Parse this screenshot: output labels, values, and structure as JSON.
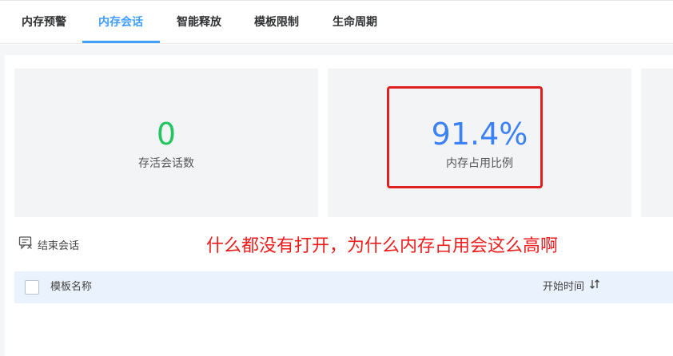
{
  "tabs": [
    {
      "label": "内存预警"
    },
    {
      "label": "内存会话"
    },
    {
      "label": "智能释放"
    },
    {
      "label": "模板限制"
    },
    {
      "label": "生命周期"
    }
  ],
  "stats": {
    "sessions": {
      "value": "0",
      "label": "存活会话数",
      "color": "#22c55e"
    },
    "memory": {
      "value": "91.4%",
      "label": "内存占用比例",
      "color": "#3b82f6"
    }
  },
  "actions": {
    "end_session": "结束会话"
  },
  "annotation": "什么都没有打开，为什么内存占用会这么高啊",
  "table": {
    "columns": [
      "模板名称",
      "开始时间"
    ]
  },
  "colors": {
    "accent": "#409eff",
    "annotation": "#ee1c1c",
    "highlight": "#e02020"
  },
  "icons": [
    "end-session-icon",
    "sort-icon"
  ]
}
